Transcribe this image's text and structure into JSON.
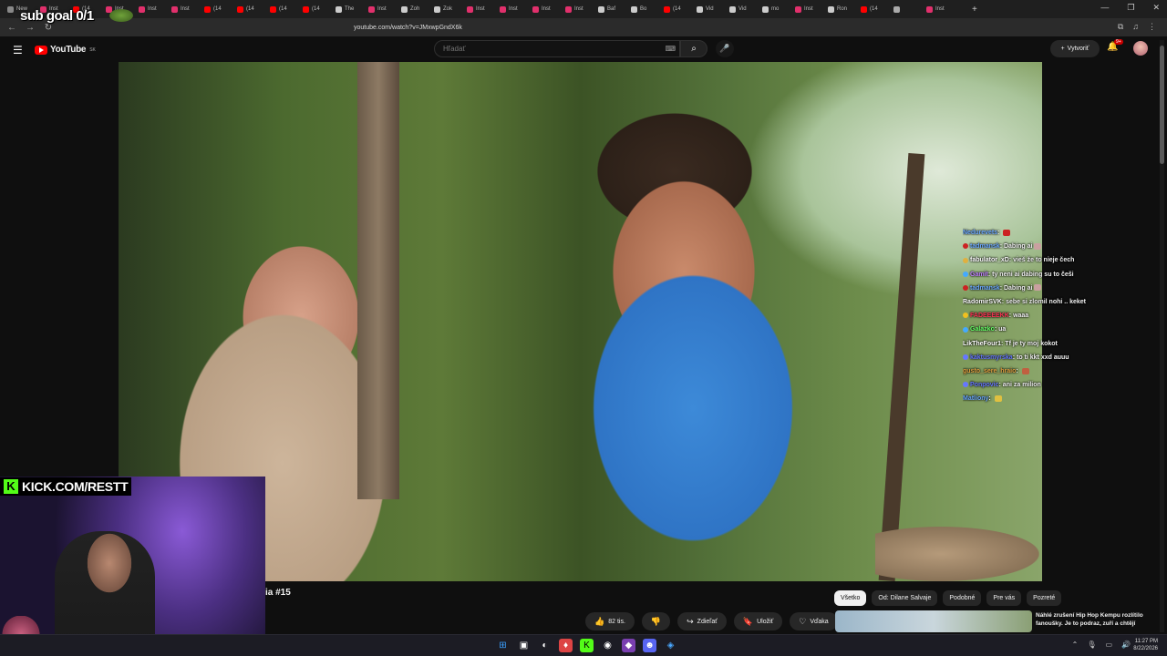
{
  "overlay": {
    "sub_goal": "sub goal 0/1",
    "kick_url": "KICK.COM/RESTT",
    "kick_letter": "K"
  },
  "browser": {
    "tabs": [
      "New",
      "Inst",
      "(14",
      "Inst",
      "Inst",
      "Inst",
      "(14",
      "(14",
      "(14",
      "(14",
      "The",
      "Inst",
      "Zoh",
      "Zok",
      "Inst",
      "Inst",
      "Inst",
      "Inst",
      "Baf",
      "Bo",
      "(14",
      "Vid",
      "Vid",
      "mo",
      "Inst",
      "Ron",
      "(14",
      "",
      "Inst"
    ],
    "tab_colors": [
      "#888888",
      "#e1306c",
      "#ff0000",
      "#e1306c",
      "#e1306c",
      "#e1306c",
      "#ff0000",
      "#ff0000",
      "#ff0000",
      "#ff0000",
      "#cccccc",
      "#e1306c",
      "#cccccc",
      "#cccccc",
      "#e1306c",
      "#e1306c",
      "#e1306c",
      "#e1306c",
      "#cccccc",
      "#cccccc",
      "#ff0000",
      "#cccccc",
      "#cccccc",
      "#cccccc",
      "#e1306c",
      "#cccccc",
      "#ff0000",
      "#aaaaaa",
      "#e1306c"
    ],
    "url": "youtube.com/watch?v=JMxwpGndX6k",
    "new_tab": "+",
    "window_controls": [
      "—",
      "❐",
      "✕"
    ]
  },
  "youtube": {
    "logo": "YouTube",
    "region": "SK",
    "search_placeholder": "Hľadať",
    "create_label": "Vytvoriť",
    "notif_count": "9+",
    "video_title_fragment": "ia #15",
    "actions": {
      "likes": "82 tis.",
      "share": "Zdieľať",
      "save": "Uložiť",
      "thanks": "Vďaka",
      "more": "···"
    },
    "chips": [
      "Všetko",
      "Od: Dilane Salvaje",
      "Podobné",
      "Pre vás",
      "Pozreté"
    ],
    "rec_title": "Náhlé zrušení Hip Hop Kempu rozlítilo fanoušky. Je to podraz, zuří a chtějí"
  },
  "chat": [
    {
      "user": "Nedurevets",
      "msg": "",
      "color": "#6aa8ff",
      "badge": "",
      "emote": "#cc2222"
    },
    {
      "user": "tadmansk",
      "msg": "Dabing ai",
      "color": "#6aa8ff",
      "badge": "#cc2222",
      "emote": "#c9a0a0"
    },
    {
      "user": "fabulator_xD",
      "msg": "vieš že to nieje čech",
      "color": "#ffffff",
      "badge": "#e0b040",
      "emote": ""
    },
    {
      "user": "Gamit",
      "msg": "ty neni ai dabing su to češi",
      "color": "#c080ff",
      "badge": "#44aaff",
      "emote": ""
    },
    {
      "user": "tadmansk",
      "msg": "Dabing ai",
      "color": "#6aa8ff",
      "badge": "#cc2222",
      "emote": "#c9a0a0"
    },
    {
      "user": "RadomirSVK",
      "msg": "sebe si zlomil nohi .. keket",
      "color": "#ffffff",
      "badge": "",
      "emote": ""
    },
    {
      "user": "FADEEEEKK",
      "msg": "waaa",
      "color": "#ff3355",
      "badge": "#f0c020",
      "emote": ""
    },
    {
      "user": "Galazko",
      "msg": "ua",
      "color": "#66ff66",
      "badge": "#44aaff",
      "emote": ""
    },
    {
      "user": "LikTheFour1",
      "msg": "Tf je ty moj kokot",
      "color": "#ffffff",
      "badge": "",
      "emote": ""
    },
    {
      "user": "kaktusmyrska",
      "msg": "to ti kkt xxd auuu",
      "color": "#6677ff",
      "badge": "#6677ff",
      "emote": ""
    },
    {
      "user": "gusto_sere_hraio",
      "msg": "",
      "color": "#e0a040",
      "badge": "",
      "emote": "#c06040"
    },
    {
      "user": "Ponpovic",
      "msg": "ani za milion",
      "color": "#6677ff",
      "badge": "#6677ff",
      "emote": ""
    },
    {
      "user": "Matliony",
      "msg": "",
      "color": "#6aa8ff",
      "badge": "",
      "emote": "#e0c040"
    }
  ],
  "taskbar": {
    "clock_time": "11:27 PM",
    "clock_date": "8/22/2026"
  },
  "colors": {
    "accent": "#ff0000",
    "kick_green": "#53fc18",
    "bg": "#0f0f0f"
  }
}
